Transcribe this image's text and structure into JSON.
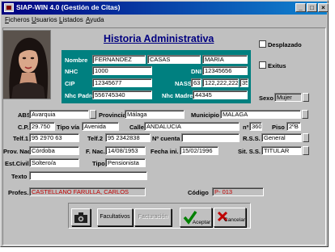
{
  "window": {
    "title": "SIAP-WIN 4.0 (Gestión de Citas)",
    "minimize": "_",
    "maximize": "□",
    "close": "×"
  },
  "menu": [
    "Ficheros",
    "Usuarios",
    "Listados",
    "Ayuda"
  ],
  "heading": "Historia Administrativa",
  "flags": {
    "desplazado": "Desplazado",
    "exitus": "Exitus"
  },
  "patient": {
    "nombre_label": "Nombre",
    "apellido1": "FERNANDEZ",
    "apellido2": "CASAS",
    "nombre": "MARIA",
    "nhc_label": "NHC",
    "nhc": "1000",
    "dni_label": "DNI",
    "dni": "12345656",
    "cip_label": "CIP",
    "cip": "12345677",
    "nass_label": "NASS",
    "nass_prefix": "63",
    "nass": "122,222,222",
    "nass_suffix": "35",
    "nhc_padre_label": "Nhc Padre",
    "nhc_padre": "556745340",
    "nhc_madre_label": "Nhc Madre",
    "nhc_madre": "44345"
  },
  "sexo": {
    "label": "Sexo",
    "value": "Mujer"
  },
  "address": {
    "abs_label": "ABS",
    "abs": "Avarquia",
    "provincia_label": "Provincia",
    "provincia": "Málaga",
    "municipio_label": "Municipio",
    "municipio": "MALAGA",
    "cp_label": "C.P.",
    "cp": "29.750",
    "tipo_via_label": "Tipo vía",
    "tipo_via": "Avenida",
    "calle_label": "Calle",
    "calle": "ANDALUCIA",
    "num_label": "nº",
    "num": "360",
    "piso_label": "Piso",
    "piso": "2ºB"
  },
  "contact": {
    "telf1_label": "Telf.1",
    "telf1": "95 2970 63",
    "telf2_label": "Telf.2",
    "telf2": "95 2342838",
    "cuenta_label": "Nº cuenta",
    "cuenta": "",
    "rss_label": "R.S.S.",
    "rss": "General"
  },
  "personal": {
    "prov_nac_label": "Prov. Nac.",
    "prov_nac": "Córdoba",
    "f_nac_label": "F. Nac.",
    "f_nac": "14/08/1953",
    "fecha_ini_label": "Fecha ini.",
    "fecha_ini": "15/02/1996",
    "sit_ss_label": "Sit. S.S.",
    "sit_ss": "TITULAR",
    "est_civil_label": "Est.Civil",
    "est_civil": "Soltero/a",
    "tipo_label": "Tipo",
    "tipo": "Pensionista",
    "texto_label": "Texto",
    "texto": ""
  },
  "doctor": {
    "profes_label": "Profes.",
    "profes": "CASTELLANO FARULLA, CARLOS",
    "codigo_label": "Código",
    "codigo": "P- 013"
  },
  "buttons": {
    "camera": "camera-icon",
    "facultativos": "Facultativos",
    "facturacion": "Facturación",
    "aceptar": "Aceptar",
    "cancelar": "Cancelar"
  },
  "colors": {
    "title_bar": "#000080",
    "teal_panel": "#008080",
    "heading": "#000080",
    "accept_check": "#008000",
    "cancel_x": "#c00000",
    "doctor_text": "#c00000"
  }
}
